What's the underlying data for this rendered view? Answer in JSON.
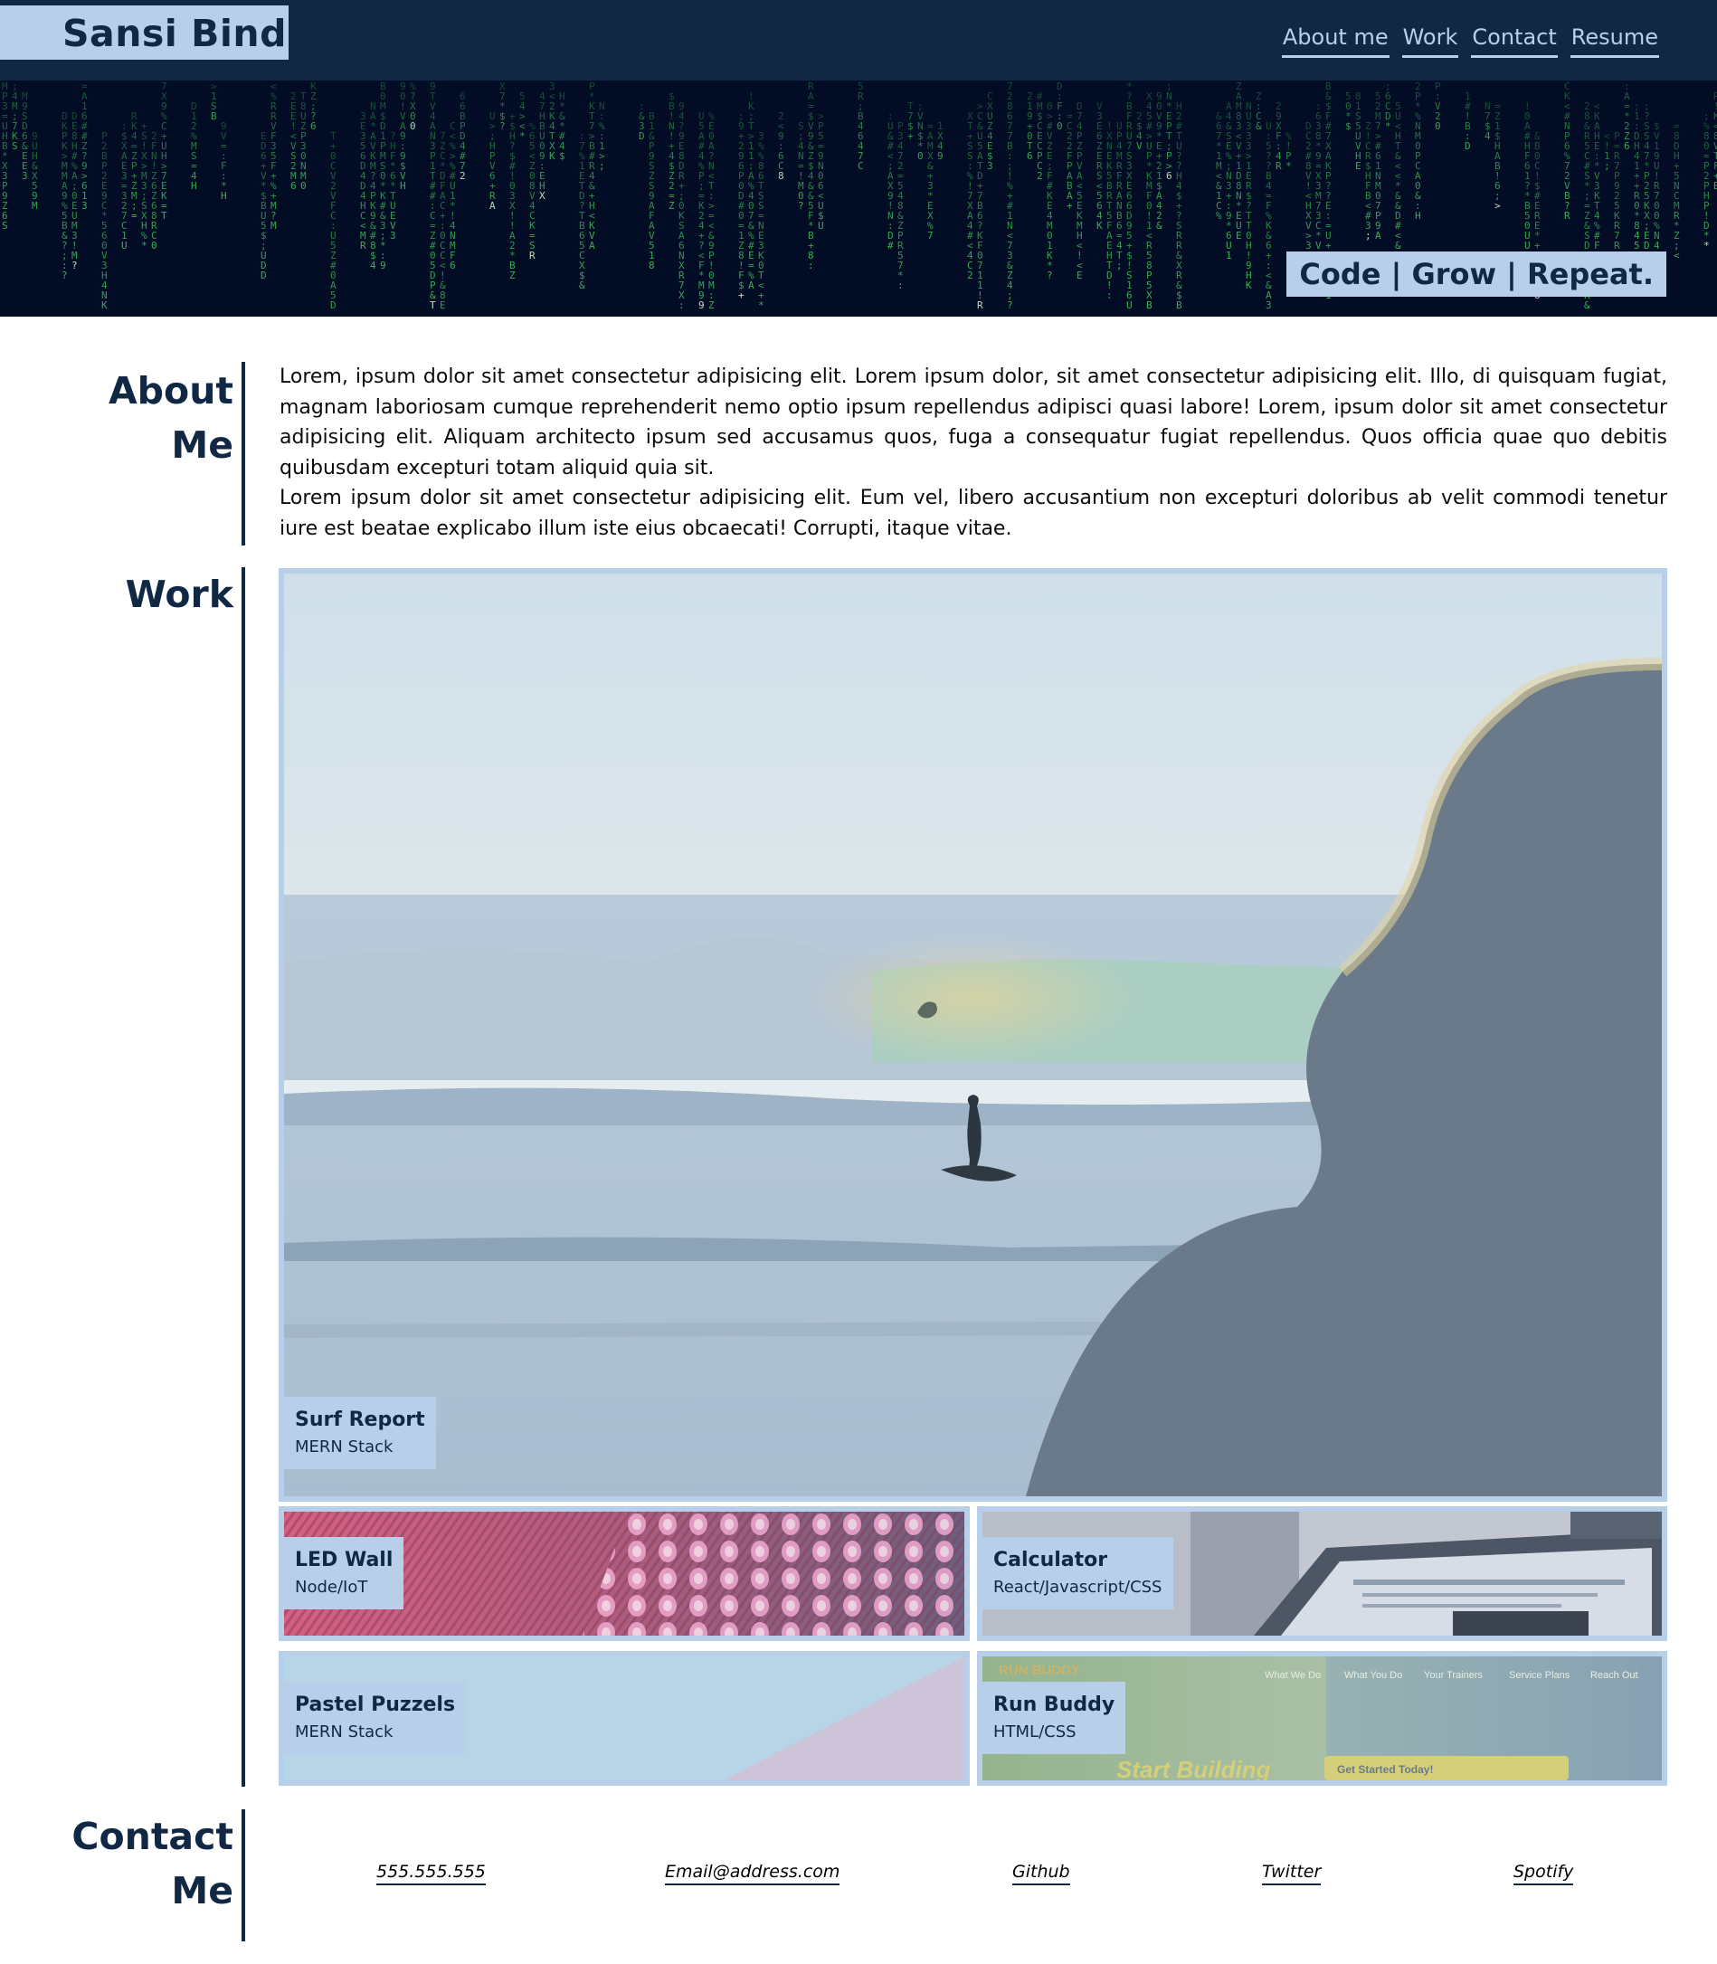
{
  "header": {
    "brand": "Sansi Bindika",
    "nav": [
      "About me",
      "Work",
      "Contact",
      "Resume"
    ]
  },
  "hero": {
    "tagline": "Code | Grow | Repeat."
  },
  "about": {
    "title": "About Me",
    "paragraph1": "Lorem, ipsum dolor sit amet consectetur adipisicing elit. Lorem ipsum dolor, sit amet consectetur adipisicing elit. Illo, di quisquam fugiat, magnam laboriosam cumque reprehenderit nemo optio ipsum repellendus adipisci quasi labore! Lorem, ipsum dolor sit amet consectetur adipisicing elit. Aliquam architecto ipsum sed accusamus quos, fuga a consequatur fugiat repellendus. Quos officia quae quo debitis quibusdam excepturi totam aliquid quia sit.",
    "paragraph2": "Lorem ipsum dolor sit amet consectetur adipisicing elit. Eum vel, libero accusantium non excepturi doloribus ab velit commodi tenetur iure est beatae explicabo illum iste eius obcaecati! Corrupti, itaque vitae."
  },
  "work": {
    "title": "Work",
    "projects": [
      {
        "name": "Surf Report",
        "stack": "MERN Stack"
      },
      {
        "name": "LED Wall",
        "stack": "Node/IoT"
      },
      {
        "name": "Calculator",
        "stack": "React/Javascript/CSS"
      },
      {
        "name": "Pastel Puzzels",
        "stack": "MERN Stack"
      },
      {
        "name": "Run Buddy",
        "stack": "HTML/CSS"
      }
    ],
    "run_buddy_preview": {
      "logo": "RUN BUDDY",
      "nav": [
        "What We Do",
        "What You Do",
        "Your Trainers",
        "Service Plans",
        "Reach Out"
      ],
      "headline": "Start Building",
      "cta": "Get Started Today!"
    }
  },
  "contact": {
    "title": "Contact Me",
    "links": [
      "555.555.555",
      "Email@address.com",
      "Github",
      "Twitter",
      "Spotify"
    ]
  },
  "colors": {
    "navy": "#112845",
    "light_blue": "#b8cfe9",
    "matrix_bg": "#020c24",
    "matrix_green": "#3fbf5a"
  }
}
